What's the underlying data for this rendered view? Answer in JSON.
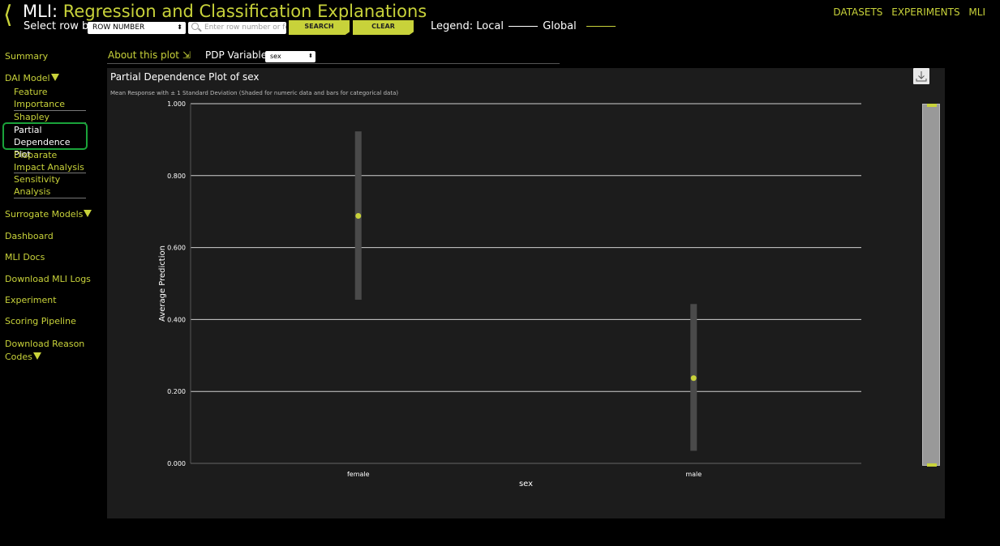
{
  "header": {
    "title_prefix": "MLI:",
    "title_rest": "Regression and Classification Explanations",
    "select_row_label": "Select row by:",
    "row_select_value": "ROW NUMBER",
    "row_search_placeholder": "Enter row number or fe",
    "search_label": "SEARCH",
    "clear_label": "CLEAR",
    "legend_label": "Legend: Local",
    "legend_global": "Global"
  },
  "top_nav": [
    "DATASETS",
    "EXPERIMENTS",
    "MLI"
  ],
  "sidebar": {
    "summary": "Summary",
    "dai_model": "DAI Model",
    "sub": {
      "feature_importance": "Feature Importance",
      "shapley": "Shapley",
      "pdp": "Partial Dependence Plot",
      "disparate": "Disparate Impact Analysis",
      "sensitivity": "Sensitivity Analysis"
    },
    "surrogate": "Surrogate Models",
    "dashboard": "Dashboard",
    "mli_docs": "MLI Docs",
    "download_logs": "Download MLI Logs",
    "experiment": "Experiment",
    "scoring": "Scoring Pipeline",
    "reason_codes": "Download Reason Codes"
  },
  "controls": {
    "about": "About this plot ⇲",
    "pdp_label": "PDP Variable:",
    "pdp_value": "sex"
  },
  "colors": {
    "accent": "#c8d23a",
    "panel": "#1c1c1c"
  },
  "icons": {
    "download": "download-icon",
    "back": "chevron-left-icon",
    "search": "search-icon"
  },
  "chart_data": {
    "type": "scatter",
    "title": "Partial Dependence Plot of sex",
    "subtitle": "Mean Response with ± 1 Standard Deviation (Shaded for numeric data and bars for categorical data)",
    "xlabel": "sex",
    "ylabel": "Average Prediction",
    "categories": [
      "female",
      "male"
    ],
    "values": [
      0.688,
      0.237
    ],
    "std_low": [
      0.455,
      0.035
    ],
    "std_high": [
      0.923,
      0.443
    ],
    "ylim": [
      0,
      1
    ],
    "yticks": [
      "0.000",
      "0.200",
      "0.400",
      "0.600",
      "0.800",
      "1.000"
    ],
    "grid": true
  }
}
